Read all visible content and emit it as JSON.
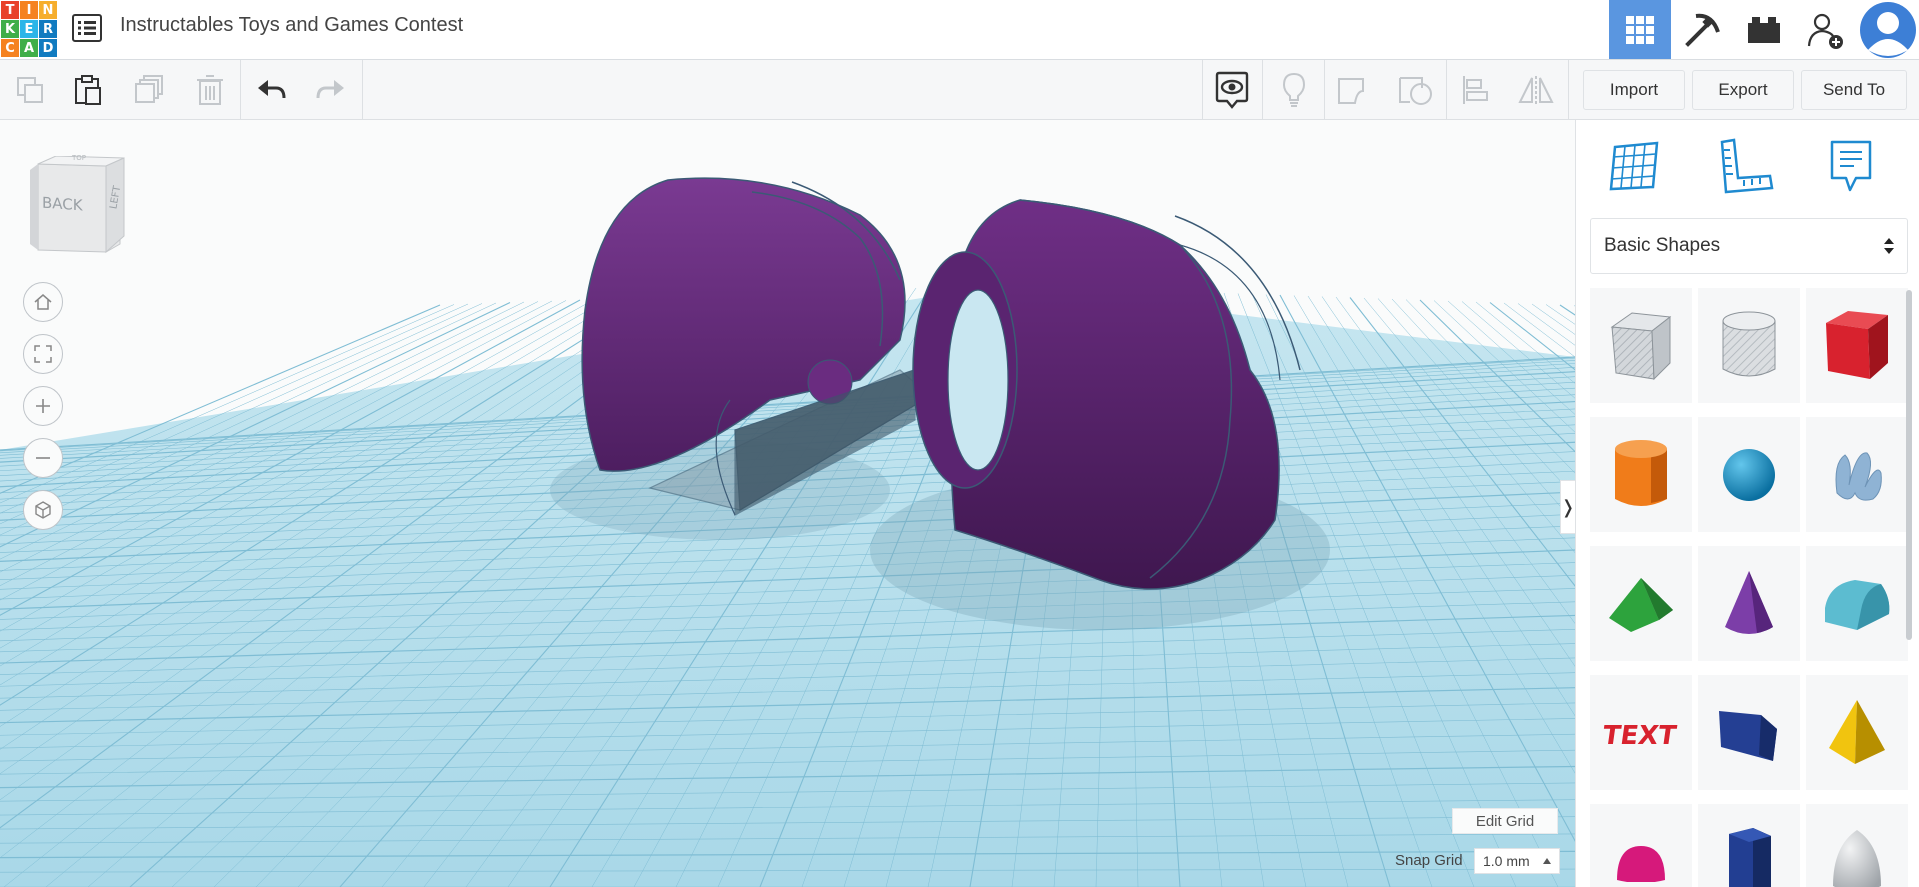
{
  "app": {
    "logo_letters": [
      "T",
      "I",
      "N",
      "K",
      "E",
      "R",
      "C",
      "A",
      "D"
    ],
    "logo_colors": [
      "#e8412a",
      "#f58220",
      "#f6ae2d",
      "#3fae49",
      "#2bb5e8",
      "#117bc0",
      "#f58220",
      "#3fae49",
      "#117bc0"
    ],
    "project_title": "Instructables Toys and Games Contest"
  },
  "header": {
    "buttons": [
      {
        "name": "3d-design-view-button",
        "icon": "grid-apps-icon",
        "active": true
      },
      {
        "name": "codeblocks-button",
        "icon": "pickaxe-icon",
        "active": false
      },
      {
        "name": "bricks-button",
        "icon": "lego-brick-icon",
        "active": false
      },
      {
        "name": "invite-user-button",
        "icon": "add-user-icon",
        "active": false
      },
      {
        "name": "profile-button",
        "icon": "avatar-icon",
        "active": false
      }
    ]
  },
  "toolbar": {
    "import_label": "Import",
    "export_label": "Export",
    "send_to_label": "Send To",
    "tools": [
      "copy-icon",
      "paste-icon",
      "duplicate-icon",
      "delete-icon",
      "undo-icon",
      "redo-icon",
      "show-all-icon",
      "notes-icon",
      "shape-hole-icon",
      "group-icon",
      "align-icon",
      "mirror-icon"
    ]
  },
  "viewport": {
    "viewcube": {
      "back_label": "BACK",
      "left_label": "LEFT",
      "top_label": "TOP"
    },
    "edit_grid_label": "Edit Grid",
    "snap_grid_label": "Snap Grid",
    "snap_grid_value": "1.0 mm",
    "collapse_glyph": "❭",
    "object_color": "#6f2f86"
  },
  "panel": {
    "category": "Basic Shapes",
    "top_icons": [
      "workplane-icon",
      "ruler-icon",
      "notes-icon"
    ],
    "shapes": [
      {
        "name": "box-hole",
        "color": "#c8cdd3"
      },
      {
        "name": "cylinder-hole",
        "color": "#c8cdd3"
      },
      {
        "name": "box",
        "color": "#d8222e"
      },
      {
        "name": "cylinder",
        "color": "#f07c1a"
      },
      {
        "name": "sphere",
        "color": "#1d9bd1"
      },
      {
        "name": "scribble",
        "color": "#8fb3d4"
      },
      {
        "name": "roof",
        "color": "#2da33d"
      },
      {
        "name": "cone",
        "color": "#7c3ea8"
      },
      {
        "name": "round-roof",
        "color": "#5cbcd0"
      },
      {
        "name": "text",
        "color": "#d8222e"
      },
      {
        "name": "wedge",
        "color": "#243f93"
      },
      {
        "name": "pyramid",
        "color": "#f1c40f"
      },
      {
        "name": "half-sphere",
        "color": "#d6197b"
      },
      {
        "name": "polygon",
        "color": "#223e92"
      },
      {
        "name": "paraboloid",
        "color": "#c8cbce"
      }
    ],
    "text_shape_label": "TEXT"
  }
}
